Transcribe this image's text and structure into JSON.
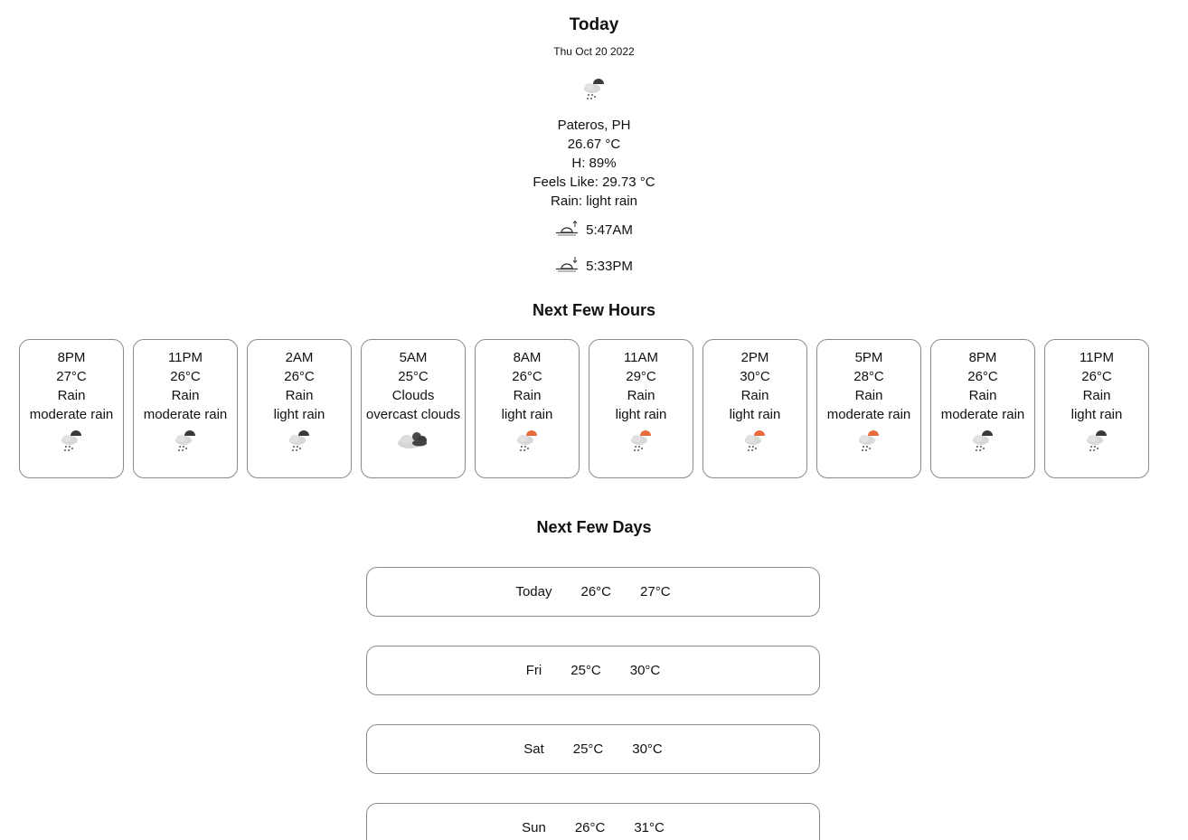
{
  "today": {
    "title": "Today",
    "date": "Thu Oct 20 2022",
    "icon": "night-rain-icon",
    "location": "Pateros, PH",
    "temp": "26.67 °C",
    "humidity": "H: 89%",
    "feels_like": "Feels Like: 29.73 °C",
    "condition": "Rain: light rain",
    "sunrise": "5:47AM",
    "sunset": "5:33PM"
  },
  "hours_section": {
    "title": "Next Few Hours"
  },
  "hours": [
    {
      "time": "8PM",
      "temp": "27°C",
      "main": "Rain",
      "desc": "moderate rain",
      "icon": "night-rain-icon"
    },
    {
      "time": "11PM",
      "temp": "26°C",
      "main": "Rain",
      "desc": "moderate rain",
      "icon": "night-rain-icon"
    },
    {
      "time": "2AM",
      "temp": "26°C",
      "main": "Rain",
      "desc": "light rain",
      "icon": "night-rain-icon"
    },
    {
      "time": "5AM",
      "temp": "25°C",
      "main": "Clouds",
      "desc": "overcast clouds",
      "icon": "overcast-clouds-icon"
    },
    {
      "time": "8AM",
      "temp": "26°C",
      "main": "Rain",
      "desc": "light rain",
      "icon": "day-rain-icon"
    },
    {
      "time": "11AM",
      "temp": "29°C",
      "main": "Rain",
      "desc": "light rain",
      "icon": "day-rain-icon"
    },
    {
      "time": "2PM",
      "temp": "30°C",
      "main": "Rain",
      "desc": "light rain",
      "icon": "day-rain-icon"
    },
    {
      "time": "5PM",
      "temp": "28°C",
      "main": "Rain",
      "desc": "moderate rain",
      "icon": "day-rain-icon"
    },
    {
      "time": "8PM",
      "temp": "26°C",
      "main": "Rain",
      "desc": "moderate rain",
      "icon": "night-rain-icon"
    },
    {
      "time": "11PM",
      "temp": "26°C",
      "main": "Rain",
      "desc": "light rain",
      "icon": "night-rain-icon"
    }
  ],
  "days_section": {
    "title": "Next Few Days"
  },
  "days": [
    {
      "day": "Today",
      "low": "26°C",
      "high": "27°C"
    },
    {
      "day": "Fri",
      "low": "25°C",
      "high": "30°C"
    },
    {
      "day": "Sat",
      "low": "25°C",
      "high": "30°C"
    },
    {
      "day": "Sun",
      "low": "26°C",
      "high": "31°C"
    }
  ],
  "colors": {
    "sun": "#e8693a",
    "moon": "#3a3a3a",
    "cloud": "#d8d8d8",
    "border": "#8a8a8a"
  }
}
